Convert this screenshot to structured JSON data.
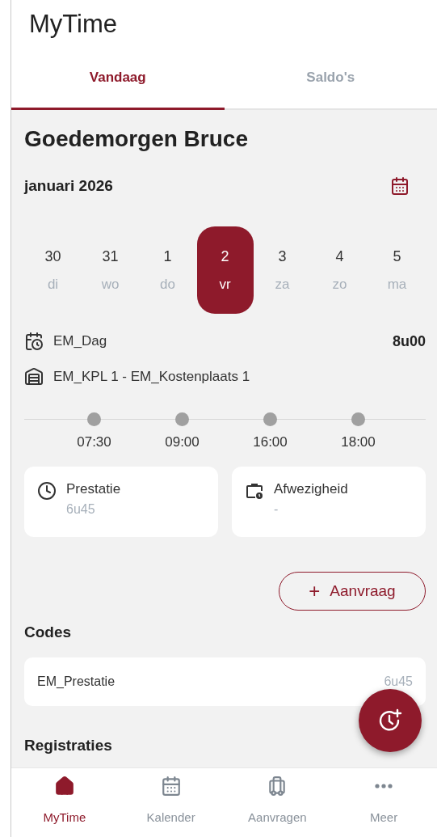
{
  "header": {
    "title": "MyTime"
  },
  "tabs": [
    {
      "label": "Vandaag",
      "selected": true
    },
    {
      "label": "Saldo's",
      "selected": false
    }
  ],
  "greeting": "Goedemorgen Bruce",
  "month": "januari 2026",
  "days": [
    {
      "date": "30",
      "weekday": "di",
      "selected": false
    },
    {
      "date": "31",
      "weekday": "wo",
      "selected": false
    },
    {
      "date": "1",
      "weekday": "do",
      "selected": false
    },
    {
      "date": "2",
      "weekday": "vr",
      "selected": true
    },
    {
      "date": "3",
      "weekday": "za",
      "selected": false
    },
    {
      "date": "4",
      "weekday": "zo",
      "selected": false
    },
    {
      "date": "5",
      "weekday": "ma",
      "selected": false
    }
  ],
  "schedule": {
    "name": "EM_Dag",
    "hours": "8u00"
  },
  "cost_center": "EM_KPL 1 - EM_Kostenplaats 1",
  "timeline": [
    "07:30",
    "09:00",
    "16:00",
    "18:00"
  ],
  "summary": [
    {
      "kind": "performance",
      "label": "Prestatie",
      "value": "6u45"
    },
    {
      "kind": "absence",
      "label": "Afwezigheid",
      "value": "-"
    }
  ],
  "request_button": {
    "icon": "+",
    "label": "Aanvraag"
  },
  "codes": {
    "title": "Codes",
    "items": [
      {
        "name": "EM_Prestatie",
        "value": "6u45"
      }
    ]
  },
  "registrations": {
    "title": "Registraties"
  },
  "bottom_nav": [
    {
      "label": "MyTime",
      "selected": true
    },
    {
      "label": "Kalender",
      "selected": false
    },
    {
      "label": "Aanvragen",
      "selected": false
    },
    {
      "label": "Meer",
      "selected": false
    }
  ]
}
